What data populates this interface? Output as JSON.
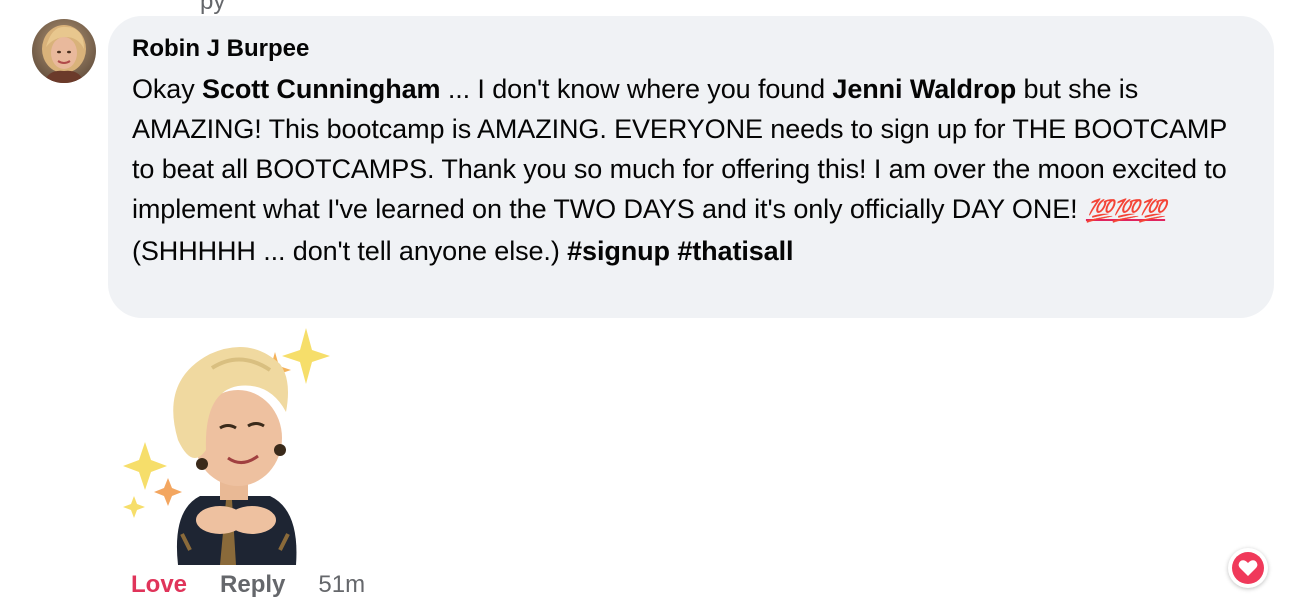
{
  "top_fragment": "py",
  "comment": {
    "author": "Robin J Burpee",
    "segments": [
      {
        "type": "text",
        "value": "Okay "
      },
      {
        "type": "mention",
        "value": "Scott Cunningham"
      },
      {
        "type": "text",
        "value": " ... I don't know where you found "
      },
      {
        "type": "mention",
        "value": "Jenni Waldrop"
      },
      {
        "type": "text",
        "value": " but she is AMAZING! This bootcamp is AMAZING. EVERYONE needs to sign up for THE BOOTCAMP to beat all BOOTCAMPS. Thank you so much for offering this! I am over the moon excited to implement what I've learned on the TWO DAYS and it's only officially DAY ONE! "
      },
      {
        "type": "emoji",
        "value": "💯💯💯"
      },
      {
        "type": "text",
        "value": " (SHHHHH ... don't tell anyone else.) "
      },
      {
        "type": "hashtag",
        "value": "#signup"
      },
      {
        "type": "text",
        "value": " "
      },
      {
        "type": "hashtag",
        "value": "#thatisall"
      }
    ],
    "sticker": "avatar-sticker-hands-on-heart-sparkles",
    "actions": {
      "love_label": "Love",
      "reply_label": "Reply",
      "timestamp": "51m"
    },
    "reaction_icon": "heart-icon"
  },
  "colors": {
    "bubble_bg": "#f0f2f5",
    "love": "#e0345a",
    "muted": "#65676b",
    "reaction_bg": "#f0395a"
  }
}
